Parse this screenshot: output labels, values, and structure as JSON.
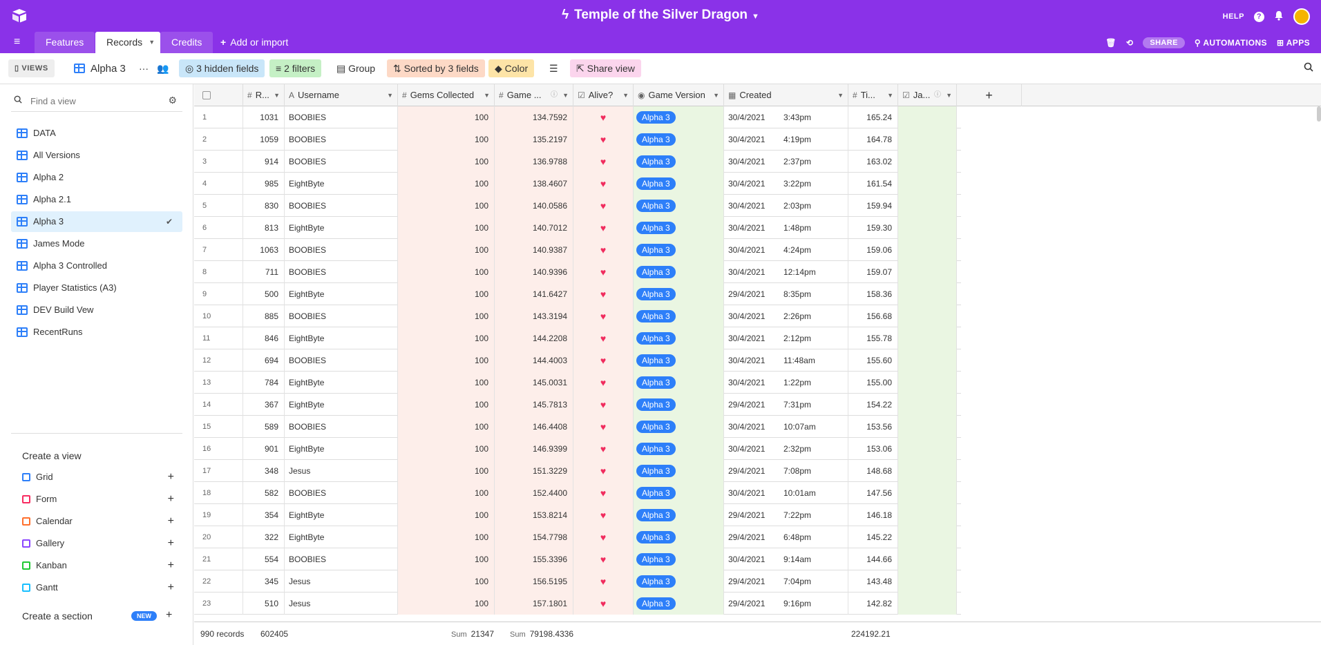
{
  "header": {
    "base_title": "Temple of the Silver Dragon",
    "help": "HELP",
    "colors": {
      "bar": "#8a32e8",
      "accent": "#2d7ff9"
    }
  },
  "tabs": [
    {
      "label": "Features"
    },
    {
      "label": "Records"
    },
    {
      "label": "Credits"
    },
    {
      "label": "Add or import"
    }
  ],
  "tabs_right": {
    "share": "SHARE",
    "automations": "AUTOMATIONS",
    "apps": "APPS"
  },
  "toolbar": {
    "views": "VIEWS",
    "view_name": "Alpha 3",
    "hidden_fields": "3 hidden fields",
    "filters": "2 filters",
    "group": "Group",
    "sorted": "Sorted by 3 fields",
    "color": "Color",
    "share_view": "Share view"
  },
  "sidebar": {
    "find_placeholder": "Find a view",
    "views": [
      {
        "label": "DATA"
      },
      {
        "label": "All Versions"
      },
      {
        "label": "Alpha 2"
      },
      {
        "label": "Alpha 2.1"
      },
      {
        "label": "Alpha 3",
        "selected": true
      },
      {
        "label": "James Mode"
      },
      {
        "label": "Alpha 3 Controlled"
      },
      {
        "label": "Player Statistics (A3)"
      },
      {
        "label": "DEV Build Vew"
      },
      {
        "label": "RecentRuns"
      }
    ],
    "create_title": "Create a view",
    "create_items": [
      {
        "label": "Grid",
        "color": "#2d7ff9"
      },
      {
        "label": "Form",
        "color": "#f82b60"
      },
      {
        "label": "Calendar",
        "color": "#ff6f2c"
      },
      {
        "label": "Gallery",
        "color": "#8b46ff"
      },
      {
        "label": "Kanban",
        "color": "#20c933"
      },
      {
        "label": "Gantt",
        "color": "#18bfff"
      }
    ],
    "create_section": "Create a section",
    "new_badge": "NEW"
  },
  "grid": {
    "columns": {
      "records": "R...",
      "username": "Username",
      "gems": "Gems Collected",
      "gametime": "Game ...",
      "alive": "Alive?",
      "version": "Game Version",
      "created": "Created",
      "time": "Ti...",
      "ja": "Ja..."
    },
    "rows": [
      {
        "n": "1",
        "rec": "1031",
        "user": "BOOBIES",
        "gems": "100",
        "game": "134.7592",
        "ver": "Alpha 3",
        "date": "30/4/2021",
        "time": "3:43pm",
        "ti": "165.24"
      },
      {
        "n": "2",
        "rec": "1059",
        "user": "BOOBIES",
        "gems": "100",
        "game": "135.2197",
        "ver": "Alpha 3",
        "date": "30/4/2021",
        "time": "4:19pm",
        "ti": "164.78"
      },
      {
        "n": "3",
        "rec": "914",
        "user": "BOOBIES",
        "gems": "100",
        "game": "136.9788",
        "ver": "Alpha 3",
        "date": "30/4/2021",
        "time": "2:37pm",
        "ti": "163.02"
      },
      {
        "n": "4",
        "rec": "985",
        "user": "EightByte",
        "gems": "100",
        "game": "138.4607",
        "ver": "Alpha 3",
        "date": "30/4/2021",
        "time": "3:22pm",
        "ti": "161.54"
      },
      {
        "n": "5",
        "rec": "830",
        "user": "BOOBIES",
        "gems": "100",
        "game": "140.0586",
        "ver": "Alpha 3",
        "date": "30/4/2021",
        "time": "2:03pm",
        "ti": "159.94"
      },
      {
        "n": "6",
        "rec": "813",
        "user": "EightByte",
        "gems": "100",
        "game": "140.7012",
        "ver": "Alpha 3",
        "date": "30/4/2021",
        "time": "1:48pm",
        "ti": "159.30"
      },
      {
        "n": "7",
        "rec": "1063",
        "user": "BOOBIES",
        "gems": "100",
        "game": "140.9387",
        "ver": "Alpha 3",
        "date": "30/4/2021",
        "time": "4:24pm",
        "ti": "159.06"
      },
      {
        "n": "8",
        "rec": "711",
        "user": "BOOBIES",
        "gems": "100",
        "game": "140.9396",
        "ver": "Alpha 3",
        "date": "30/4/2021",
        "time": "12:14pm",
        "ti": "159.07"
      },
      {
        "n": "9",
        "rec": "500",
        "user": "EightByte",
        "gems": "100",
        "game": "141.6427",
        "ver": "Alpha 3",
        "date": "29/4/2021",
        "time": "8:35pm",
        "ti": "158.36"
      },
      {
        "n": "10",
        "rec": "885",
        "user": "BOOBIES",
        "gems": "100",
        "game": "143.3194",
        "ver": "Alpha 3",
        "date": "30/4/2021",
        "time": "2:26pm",
        "ti": "156.68"
      },
      {
        "n": "11",
        "rec": "846",
        "user": "EightByte",
        "gems": "100",
        "game": "144.2208",
        "ver": "Alpha 3",
        "date": "30/4/2021",
        "time": "2:12pm",
        "ti": "155.78"
      },
      {
        "n": "12",
        "rec": "694",
        "user": "BOOBIES",
        "gems": "100",
        "game": "144.4003",
        "ver": "Alpha 3",
        "date": "30/4/2021",
        "time": "11:48am",
        "ti": "155.60"
      },
      {
        "n": "13",
        "rec": "784",
        "user": "EightByte",
        "gems": "100",
        "game": "145.0031",
        "ver": "Alpha 3",
        "date": "30/4/2021",
        "time": "1:22pm",
        "ti": "155.00"
      },
      {
        "n": "14",
        "rec": "367",
        "user": "EightByte",
        "gems": "100",
        "game": "145.7813",
        "ver": "Alpha 3",
        "date": "29/4/2021",
        "time": "7:31pm",
        "ti": "154.22"
      },
      {
        "n": "15",
        "rec": "589",
        "user": "BOOBIES",
        "gems": "100",
        "game": "146.4408",
        "ver": "Alpha 3",
        "date": "30/4/2021",
        "time": "10:07am",
        "ti": "153.56"
      },
      {
        "n": "16",
        "rec": "901",
        "user": "EightByte",
        "gems": "100",
        "game": "146.9399",
        "ver": "Alpha 3",
        "date": "30/4/2021",
        "time": "2:32pm",
        "ti": "153.06"
      },
      {
        "n": "17",
        "rec": "348",
        "user": "Jesus",
        "gems": "100",
        "game": "151.3229",
        "ver": "Alpha 3",
        "date": "29/4/2021",
        "time": "7:08pm",
        "ti": "148.68"
      },
      {
        "n": "18",
        "rec": "582",
        "user": "BOOBIES",
        "gems": "100",
        "game": "152.4400",
        "ver": "Alpha 3",
        "date": "30/4/2021",
        "time": "10:01am",
        "ti": "147.56"
      },
      {
        "n": "19",
        "rec": "354",
        "user": "EightByte",
        "gems": "100",
        "game": "153.8214",
        "ver": "Alpha 3",
        "date": "29/4/2021",
        "time": "7:22pm",
        "ti": "146.18"
      },
      {
        "n": "20",
        "rec": "322",
        "user": "EightByte",
        "gems": "100",
        "game": "154.7798",
        "ver": "Alpha 3",
        "date": "29/4/2021",
        "time": "6:48pm",
        "ti": "145.22"
      },
      {
        "n": "21",
        "rec": "554",
        "user": "BOOBIES",
        "gems": "100",
        "game": "155.3396",
        "ver": "Alpha 3",
        "date": "30/4/2021",
        "time": "9:14am",
        "ti": "144.66"
      },
      {
        "n": "22",
        "rec": "345",
        "user": "Jesus",
        "gems": "100",
        "game": "156.5195",
        "ver": "Alpha 3",
        "date": "29/4/2021",
        "time": "7:04pm",
        "ti": "143.48"
      },
      {
        "n": "23",
        "rec": "510",
        "user": "Jesus",
        "gems": "100",
        "game": "157.1801",
        "ver": "Alpha 3",
        "date": "29/4/2021",
        "time": "9:16pm",
        "ti": "142.82"
      }
    ],
    "footer": {
      "records": "990 records",
      "sum_label": "Sum",
      "records_sum": "602405",
      "gems_sum": "21347",
      "game_sum": "79198.4336",
      "ti_sum": "224192.21"
    }
  }
}
